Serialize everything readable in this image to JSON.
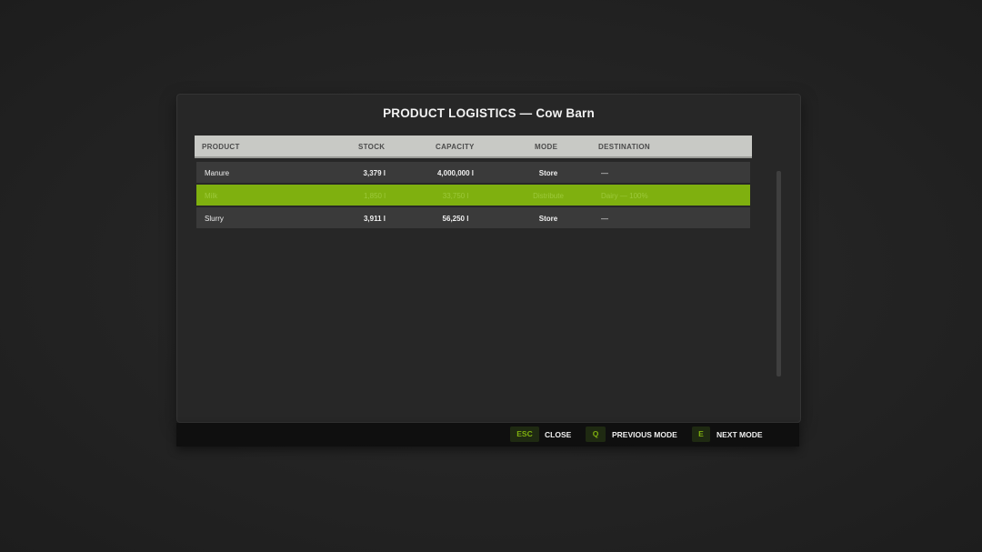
{
  "dialog": {
    "title": "PRODUCT LOGISTICS — Cow Barn"
  },
  "table": {
    "columns": {
      "product": "PRODUCT",
      "stock": "STOCK",
      "capacity": "CAPACITY",
      "mode": "MODE",
      "destination": "DESTINATION"
    },
    "rows": [
      {
        "product": "Manure",
        "stock": "3,379 l",
        "capacity": "4,000,000 l",
        "mode": "Store",
        "destination": "—",
        "selected": false
      },
      {
        "product": "Milk",
        "stock": "1,850 l",
        "capacity": "33,750 l",
        "mode": "Distribute",
        "destination": "Dairy — 100%",
        "selected": true
      },
      {
        "product": "Slurry",
        "stock": "3,911 l",
        "capacity": "56,250 l",
        "mode": "Store",
        "destination": "—",
        "selected": false
      }
    ]
  },
  "footer": {
    "actions": [
      {
        "key": "ESC",
        "label": "CLOSE"
      },
      {
        "key": "Q",
        "label": "PREVIOUS MODE"
      },
      {
        "key": "E",
        "label": "NEXT MODE"
      }
    ]
  },
  "colors": {
    "accent": "#7fb00f",
    "selected_text": "#9cc93a",
    "header_bg": "#c8c9c5",
    "row_bg": "#3a3a3a"
  }
}
